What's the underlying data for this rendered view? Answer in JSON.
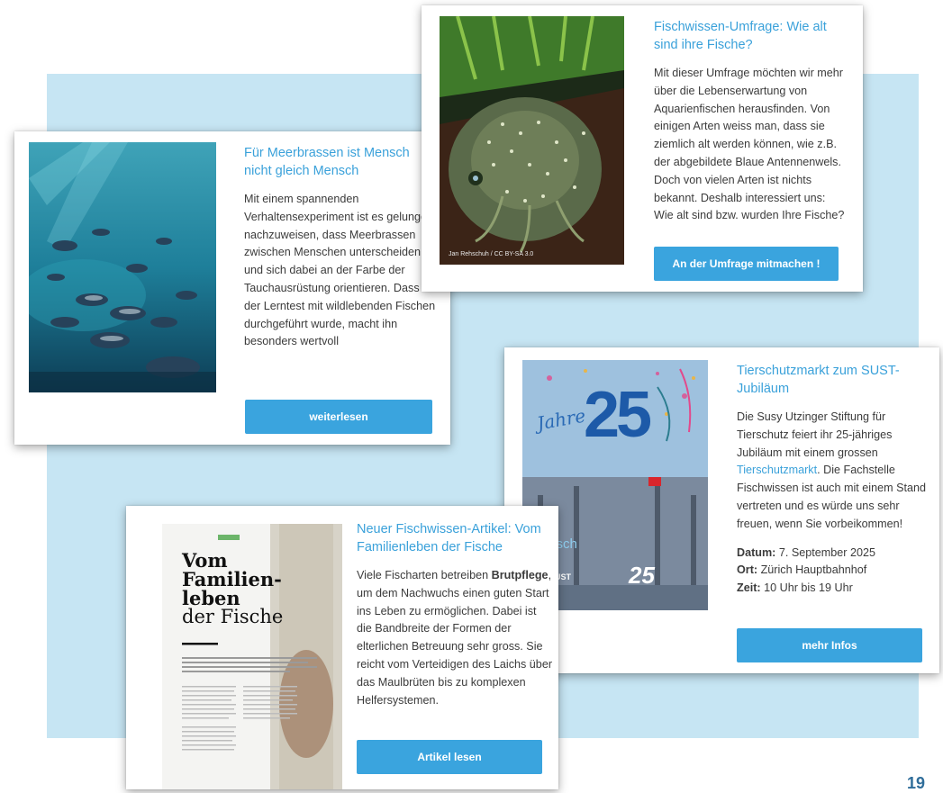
{
  "page": {
    "number": "19"
  },
  "card_seabream": {
    "title": "Für Meerbrassen ist Mensch nicht gleich Mensch",
    "body": "Mit einem spannenden Verhaltensexperiment ist es gelungen nachzuweisen, dass Meerbrassen zwischen Menschen unterscheiden und sich dabei an der Farbe der Tauchausrüstung orientieren. Dass der Lerntest mit wildlebenden Fischen durchgeführt wurde, macht ihn besonders wertvoll",
    "button": "weiterlesen"
  },
  "card_survey": {
    "title": "Fischwissen-Umfrage: Wie alt sind ihre Fische?",
    "body": "Mit dieser Umfrage möchten wir mehr über die Lebenserwartung von Aquarienfischen herausfinden. Von einigen Arten weiss man, dass sie ziemlich alt werden können, wie z.B. der abgebildete Blaue Antennenwels. Doch von vielen Arten ist nichts bekannt. Deshalb interessiert uns: Wie alt sind bzw. wurden Ihre Fische?",
    "image_credit": "Jan Rehschuh / CC BY-SA 3.0",
    "button": "An der Umfrage mitmachen !"
  },
  "card_market": {
    "title": "Tierschutzmarkt zum SUST-Jubiläum",
    "body_before": "Die Susy Utzinger Stiftung für Tierschutz feiert ihr 25-jähriges Jubiläum mit einem grossen ",
    "body_link": "Tierschutzmarkt",
    "body_after": ". Die Fachstelle Fischwissen ist auch mit einem Stand vertreten und es würde uns sehr freuen, wenn Sie vorbeikommen!",
    "date_label": "Datum:",
    "date_value": " 7. September 2025",
    "place_label": "Ort:",
    "place_value": " Zürich Hauptbahnhof",
    "time_label": "Zeit:",
    "time_value": " 10 Uhr bis 19 Uhr",
    "poster_big": "25",
    "poster_script": "Jahre",
    "poster_subtitle": "fisch",
    "poster_logo": "SUST",
    "button": "mehr Infos"
  },
  "card_article": {
    "title": "Neuer Fischwissen-Artikel: Vom Familienleben der Fische",
    "body_before": "Viele Fischarten betreiben ",
    "body_bold": "Brutpflege",
    "body_after": ", um dem Nachwuchs einen guten Start ins Leben zu ermöglichen. Dabei ist die Bandbreite der Formen der elterlichen Betreuung sehr gross. Sie reicht vom Verteidigen des Laichs über das Maulbrüten bis zu komplexen Helfersystemen.",
    "magazine_heading_1": "Vom",
    "magazine_heading_2": "Familien-",
    "magazine_heading_3": "leben",
    "magazine_heading_4": "der Fische",
    "button": "Artikel lesen"
  },
  "colors": {
    "accent": "#3aa1da",
    "button": "#3aa4de",
    "backdrop": "#c6e5f3",
    "text": "#3b3b3b"
  }
}
